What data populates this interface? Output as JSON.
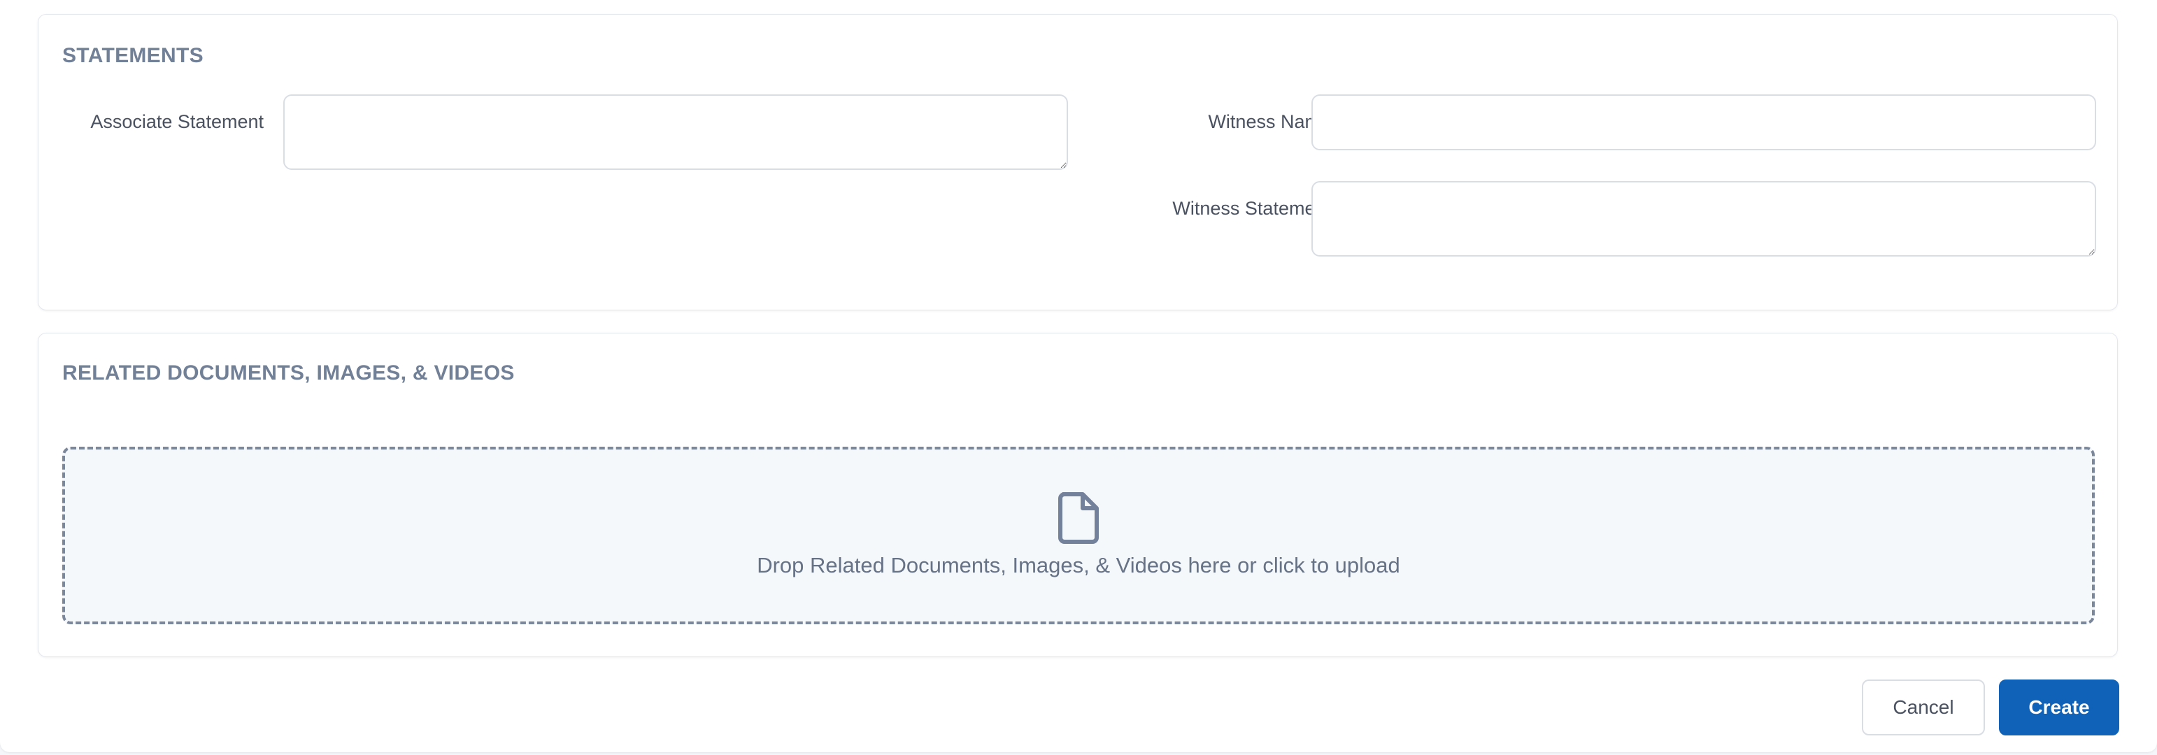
{
  "statements": {
    "title": "STATEMENTS",
    "associate_statement": {
      "label": "Associate Statement",
      "value": ""
    },
    "witness_name": {
      "label": "Witness Name",
      "value": ""
    },
    "witness_statement": {
      "label": "Witness Statement",
      "value": ""
    }
  },
  "documents": {
    "title": "RELATED DOCUMENTS, IMAGES, & VIDEOS",
    "dropzone_text": "Drop Related Documents, Images, & Videos here or click to upload",
    "icon": "file-icon"
  },
  "actions": {
    "cancel_label": "Cancel",
    "create_label": "Create"
  },
  "colors": {
    "section_title": "#718096",
    "primary_button": "#0f62b8",
    "dropzone_border": "#7b879b",
    "dropzone_bg": "#f5f8fb"
  }
}
